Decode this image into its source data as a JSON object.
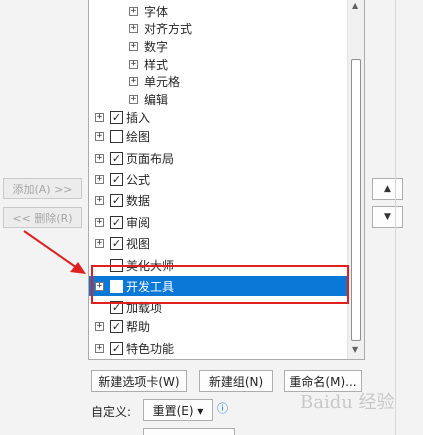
{
  "side_buttons": {
    "add": "添加(A) >>",
    "remove": "<< 删除(R)"
  },
  "tree_items": [
    {
      "label": "字体",
      "level": 2,
      "expander": "+",
      "checkbox": false
    },
    {
      "label": "对齐方式",
      "level": 2,
      "expander": "+",
      "checkbox": false
    },
    {
      "label": "数字",
      "level": 2,
      "expander": "+",
      "checkbox": false
    },
    {
      "label": "样式",
      "level": 2,
      "expander": "+",
      "checkbox": false
    },
    {
      "label": "单元格",
      "level": 2,
      "expander": "+",
      "checkbox": false
    },
    {
      "label": "编辑",
      "level": 2,
      "expander": "+",
      "checkbox": false
    },
    {
      "label": "插入",
      "level": 1,
      "expander": "+",
      "checkbox": true,
      "checked": true
    },
    {
      "label": "绘图",
      "level": 1,
      "expander": "+",
      "checkbox": true,
      "checked": false
    },
    {
      "label": "页面布局",
      "level": 1,
      "expander": "+",
      "checkbox": true,
      "checked": true
    },
    {
      "label": "公式",
      "level": 1,
      "expander": "+",
      "checkbox": true,
      "checked": true
    },
    {
      "label": "数据",
      "level": 1,
      "expander": "+",
      "checkbox": true,
      "checked": true
    },
    {
      "label": "审阅",
      "level": 1,
      "expander": "+",
      "checkbox": true,
      "checked": true
    },
    {
      "label": "视图",
      "level": 1,
      "expander": "+",
      "checkbox": true,
      "checked": true
    },
    {
      "label": "美化大师",
      "level": 1,
      "expander": "",
      "checkbox": true,
      "checked": false
    },
    {
      "label": "开发工具",
      "level": 1,
      "expander": "+",
      "checkbox": true,
      "checked": false,
      "selected": true
    },
    {
      "label": "加载项",
      "level": 1,
      "expander": "",
      "checkbox": true,
      "checked": true
    },
    {
      "label": "帮助",
      "level": 1,
      "expander": "+",
      "checkbox": true,
      "checked": true
    },
    {
      "label": "特色功能",
      "level": 1,
      "expander": "+",
      "checkbox": true,
      "checked": true
    }
  ],
  "bottom_buttons": {
    "new_tab": "新建选项卡(W)",
    "new_group": "新建组(N)",
    "rename": "重命名(M)..."
  },
  "customize": {
    "label": "自定义:",
    "reset": "重置(E) ▾",
    "info_icon": "info-icon"
  },
  "move_up": "▲",
  "move_down": "▼",
  "watermark": "Baidu 经验",
  "accent_color": "#0a78d7",
  "annotation_color": "#e02020"
}
